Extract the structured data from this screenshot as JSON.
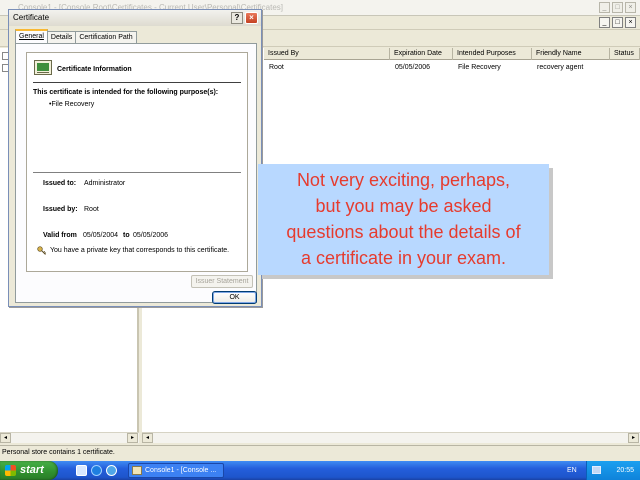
{
  "mmc": {
    "title": "Console1 - [Console Root\\Certificates - Current User\\Personal\\Certificates]",
    "window_buttons": [
      "_",
      "□",
      "×"
    ],
    "inner_buttons": [
      "_",
      "□",
      "×"
    ],
    "columns": [
      "Issued By",
      "Expiration Date",
      "Intended Purposes",
      "Friendly Name",
      "Status"
    ],
    "rows": [
      {
        "issued_by": "Root",
        "expiration": "05/05/2006",
        "purposes": "File Recovery",
        "friendly_name": "recovery agent",
        "status": ""
      }
    ],
    "status_text": "Personal store contains 1 certificate."
  },
  "dialog": {
    "title": "Certificate",
    "help_glyph": "?",
    "close_glyph": "×",
    "tabs": [
      "General",
      "Details",
      "Certification Path"
    ],
    "info_title": "Certificate Information",
    "purpose_heading": "This certificate is intended for the following purpose(s):",
    "purpose_item": "•File Recovery",
    "issued_to_label": "Issued to:",
    "issued_to_value": "Administrator",
    "issued_by_label": "Issued by:",
    "issued_by_value": "Root",
    "valid_from_label": "Valid from",
    "valid_from_value": "05/05/2004",
    "valid_to_label": "to",
    "valid_to_value": "05/05/2006",
    "private_key_note": "You have a private key that corresponds to this certificate.",
    "issuer_statement_label": "Issuer Statement",
    "ok_label": "OK"
  },
  "caption": {
    "lines": [
      "Not very exciting, perhaps,",
      "but you may be asked",
      "questions about the details of",
      "a certificate in your exam."
    ]
  },
  "taskbar": {
    "start_label": "start",
    "task_label": "Console1 - [Console ...",
    "language": "EN",
    "clock": "20:55"
  },
  "colors": {
    "caption_bg": "#b8d8ff",
    "caption_text": "#e63b2e",
    "taskbar_blue": "#245edb",
    "start_green": "#2f8f2e"
  }
}
